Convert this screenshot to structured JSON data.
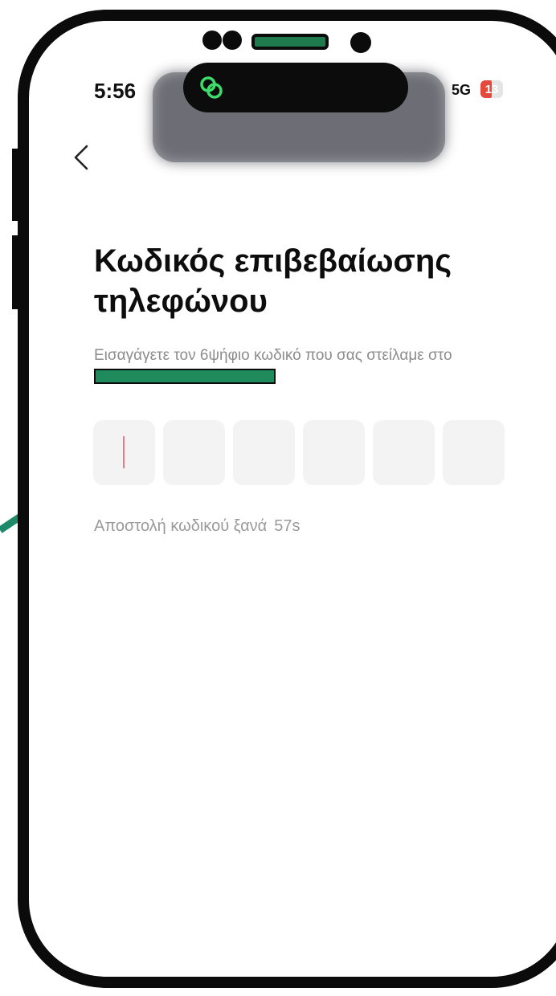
{
  "status_bar": {
    "time": "5:56",
    "network": "5G",
    "battery": "13",
    "battery_level": 0.13,
    "notification_icon": "link-rings-icon"
  },
  "nav": {
    "back_icon": "chevron-left-icon"
  },
  "screen": {
    "title": "Κωδικός επιβεβαίωσης τηλεφώνου",
    "subtitle": "Εισαγάγετε τον 6ψήφιο κωδικό που σας στείλαμε στο",
    "otp_digits": [
      "",
      "",
      "",
      "",
      "",
      ""
    ],
    "resend_label": "Αποστολή κωδικού ξανά",
    "resend_timer": "57s"
  },
  "colors": {
    "accent_green": "#1f8a5c",
    "caret": "#e87b86",
    "battery_low": "#e34a3c"
  }
}
